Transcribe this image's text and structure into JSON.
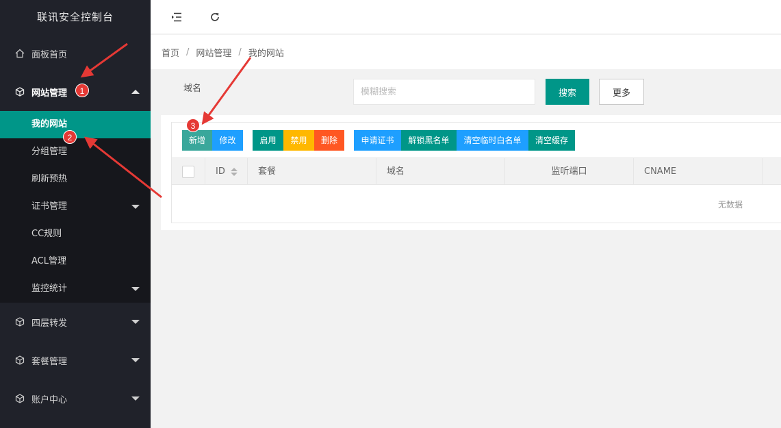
{
  "app": {
    "title": "联讯安全控制台"
  },
  "sidebar": {
    "items": [
      {
        "label": "面板首页",
        "icon": "home-icon"
      },
      {
        "label": "网站管理",
        "icon": "cube-icon",
        "expanded": true,
        "children": [
          {
            "label": "我的网站",
            "active": true
          },
          {
            "label": "分组管理"
          },
          {
            "label": "刷新预热"
          },
          {
            "label": "证书管理",
            "has_caret": true
          },
          {
            "label": "CC规则"
          },
          {
            "label": "ACL管理"
          },
          {
            "label": "监控统计",
            "has_caret": true
          }
        ]
      },
      {
        "label": "四层转发",
        "icon": "cube-icon"
      },
      {
        "label": "套餐管理",
        "icon": "cube-icon"
      },
      {
        "label": "账户中心",
        "icon": "cube-icon"
      }
    ]
  },
  "header": {
    "menu_toggle_icon": "indent-icon",
    "refresh_icon": "refresh-icon"
  },
  "breadcrumb": [
    "首页",
    "网站管理",
    "我的网站"
  ],
  "search": {
    "label": "域名",
    "placeholder": "模糊搜索",
    "search_button": "搜索",
    "more_button": "更多"
  },
  "toolbar": {
    "buttons": [
      "新增",
      "修改",
      "启用",
      "禁用",
      "删除",
      "申请证书",
      "解锁黑名单",
      "清空临时白名单",
      "清空缓存"
    ]
  },
  "table": {
    "columns": [
      "ID",
      "套餐",
      "域名",
      "监听端口",
      "CNAME"
    ],
    "empty_text": "无数据"
  },
  "annotations": {
    "badges": [
      "1",
      "2",
      "3"
    ]
  },
  "colors": {
    "primary": "#009688",
    "blue": "#1e9fff",
    "yellow": "#ffb800",
    "red": "#ff5722",
    "sidebar_bg": "#20222a",
    "annotation_red": "#e53935"
  }
}
